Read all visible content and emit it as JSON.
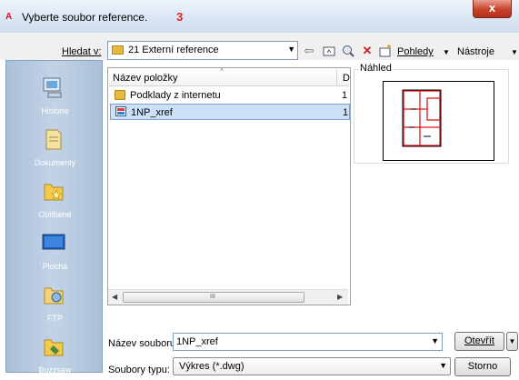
{
  "window": {
    "app_icon_text": "A",
    "title": "Vyberte soubor reference.",
    "title_number": "3",
    "close_glyph": "x"
  },
  "toolbar": {
    "look_in_label": "Hledat v:",
    "look_in_value": "21 Externí reference",
    "views_label": "Pohledy",
    "tools_label": "Nástroje"
  },
  "places": [
    {
      "label": "Historie",
      "icon": "history-icon"
    },
    {
      "label": "Dokumenty",
      "icon": "documents-icon"
    },
    {
      "label": "Oblíbené",
      "icon": "favorites-icon"
    },
    {
      "label": "Plocha",
      "icon": "desktop-icon"
    },
    {
      "label": "FTP",
      "icon": "ftp-icon"
    },
    {
      "label": "Buzzsaw",
      "icon": "buzzsaw-icon"
    }
  ],
  "file_list": {
    "column_name": "Název položky",
    "column_second": "D",
    "items": [
      {
        "name": "Podklady z internetu",
        "size": "1",
        "type": "folder"
      },
      {
        "name": "1NP_xref",
        "size": "1",
        "type": "drawing",
        "selected": true
      }
    ]
  },
  "preview": {
    "label": "Náhled"
  },
  "footer": {
    "file_name_label": "Název souboru:",
    "file_name_value": "1NP_xref",
    "file_type_label": "Soubory typu:",
    "file_type_value": "Výkres (*.dwg)",
    "open_button": "Otevřít",
    "cancel_button": "Storno"
  },
  "colors": {
    "places_bg": "#b8cbe0",
    "selection": "#cce0f7",
    "close_red": "#c7422a"
  }
}
